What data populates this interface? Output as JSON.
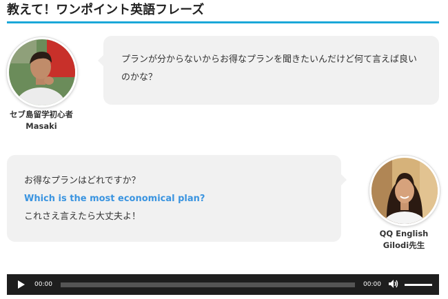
{
  "heading": "教えて！ワンポイント英語フレーズ",
  "student": {
    "name_line1": "セブ島留学初心者",
    "name_line2": "Masaki",
    "message": "プランが分からないからお得なプランを聞きたいんだけど何て言えば良いのかな？"
  },
  "teacher": {
    "name_line1": "QQ English",
    "name_line2": "Gilodi先生",
    "line1": "お得なプランはどれですか？",
    "line2_en": "Which is the most economical plan?",
    "line3": "これさえ言えたら大丈夫よ！"
  },
  "player": {
    "current_time": "00:00",
    "duration": "00:00",
    "icons": [
      "play-icon",
      "volume-icon"
    ]
  }
}
